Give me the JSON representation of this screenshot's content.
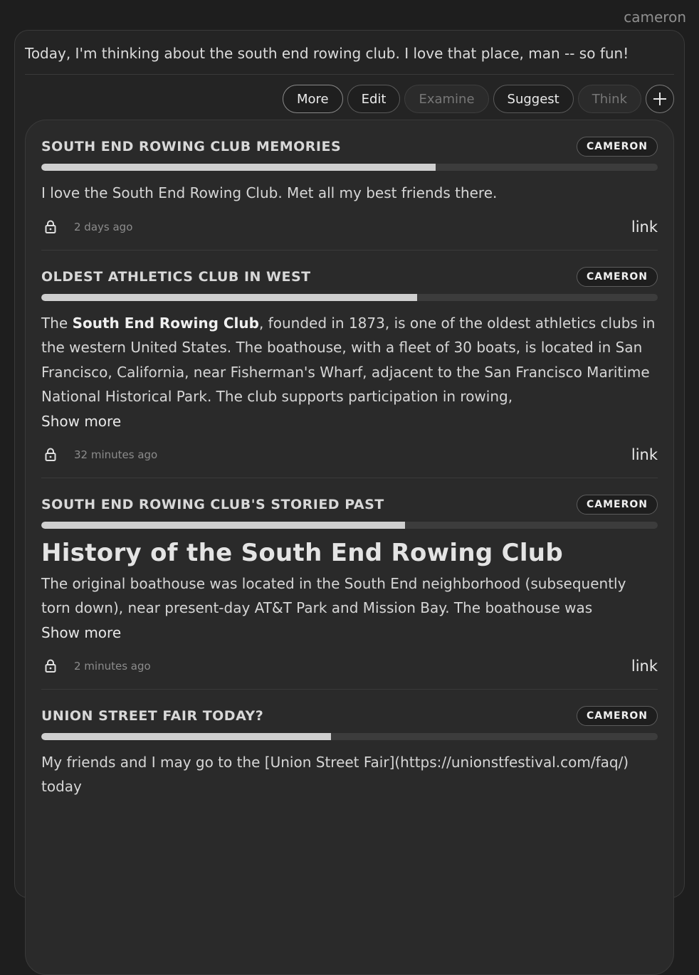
{
  "user": {
    "name": "cameron"
  },
  "post": {
    "text": "Today, I'm thinking about the south end rowing club. I love that place, man -- so fun!"
  },
  "actions": {
    "more": "More",
    "edit": "Edit",
    "examine": "Examine",
    "suggest": "Suggest",
    "think": "Think",
    "add": "+"
  },
  "cards": [
    {
      "title": "South End Rowing Club Memories",
      "author": "CAMERON",
      "progress": 0.64,
      "body": "I love the South End Rowing Club. Met all my best friends there.",
      "time": "2 days ago",
      "link": "link"
    },
    {
      "title": "Oldest Athletics Club in West",
      "author": "CAMERON",
      "progress": 0.61,
      "body_bold": "South End Rowing Club",
      "body_before": "The ",
      "body_after": ", founded in 1873, is one of the oldest athletics clubs in the western United States. The boathouse, with a fleet of 30 boats, is located in San Francisco, California, near Fisherman's Wharf, adjacent to the San Francisco Maritime National Historical Park. The club supports participation in rowing,",
      "show_more": "Show more",
      "time": "32 minutes ago",
      "link": "link"
    },
    {
      "title": "South End Rowing Club's Storied Past",
      "author": "CAMERON",
      "progress": 0.59,
      "heading": "History of the South End Rowing Club",
      "body": "The original boathouse was located in the South End neighborhood (subsequently torn down), near present-day AT&T Park and Mission Bay. The boathouse was",
      "show_more": "Show more",
      "time": "2 minutes ago",
      "link": "link"
    },
    {
      "title": "Union Street Fair today?",
      "author": "CAMERON",
      "progress": 0.47,
      "body": "My friends and I may go to the [Union Street Fair](https://unionstfestival.com/faq/) today"
    }
  ]
}
